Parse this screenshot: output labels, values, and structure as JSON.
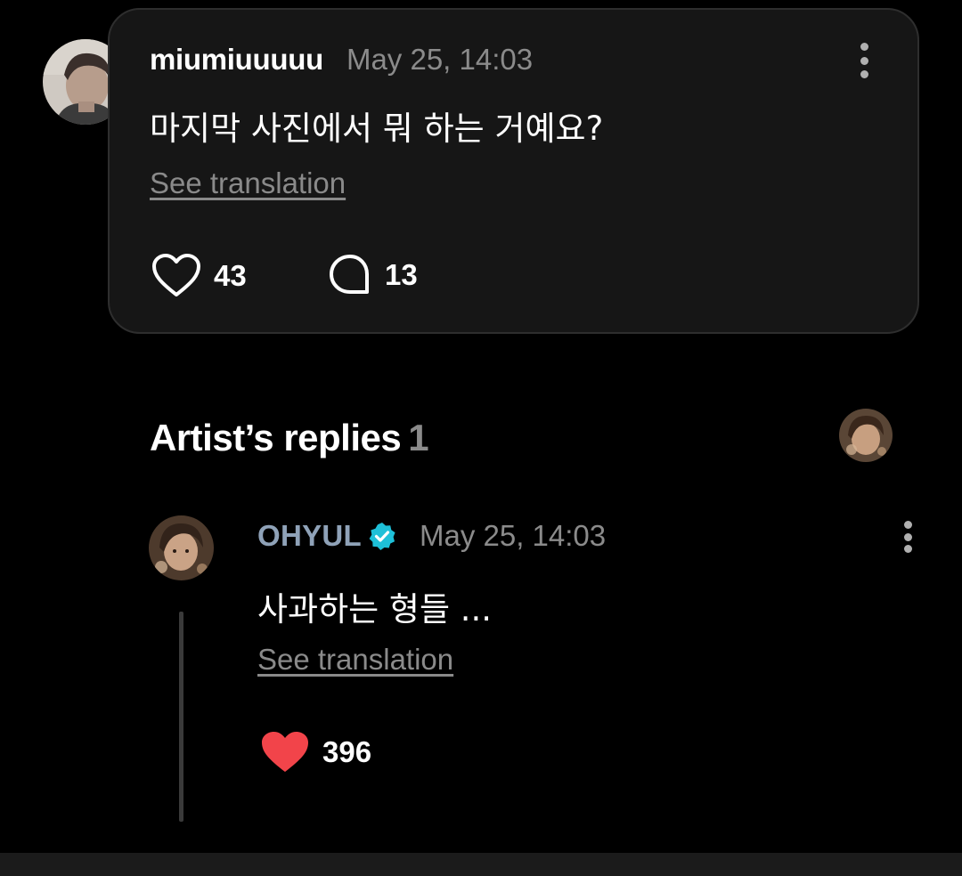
{
  "fan_comment": {
    "username": "miumiuuuuu",
    "timestamp": "May 25, 14:03",
    "text": "마지막 사진에서 뭐 하는 거예요?",
    "see_translation": "See translation",
    "likes": "43",
    "replies": "13",
    "like_icon": "heart-outline-icon",
    "reply_icon": "comment-bubble-icon"
  },
  "artist_replies": {
    "title": "Artist’s replies",
    "count": "1"
  },
  "artist_reply": {
    "name": "OHYUL",
    "verified_icon": "verified-badge-icon",
    "timestamp": "May 25, 14:03",
    "text": "사과하는 형들 ...",
    "see_translation": "See translation",
    "likes": "396",
    "like_icon": "heart-filled-icon"
  },
  "colors": {
    "background": "#000000",
    "card": "#161616",
    "card_border": "#2e2e2e",
    "muted_text": "#8b8b8b",
    "artist_name": "#8fa2b8",
    "verified": "#1ec0d8",
    "liked_heart": "#f2444a"
  }
}
